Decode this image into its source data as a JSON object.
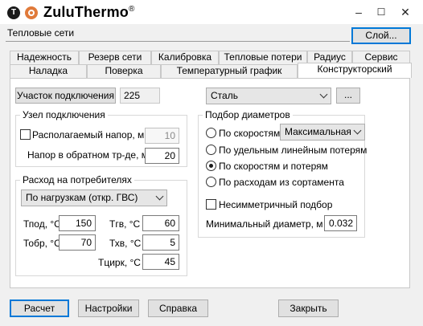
{
  "app": {
    "name": "ZuluThermo",
    "trademark": "®",
    "logo_letter": "T"
  },
  "window_controls": {
    "minimize": "–",
    "maximize": "☐",
    "close": "✕"
  },
  "layer": {
    "value": "Тепловые сети",
    "button_label": "Слой..."
  },
  "tabs_row1": [
    "Надежность",
    "Резерв сети",
    "Калибровка",
    "Тепловые потери",
    "Радиус",
    "Сервис"
  ],
  "tabs_row2": [
    "Наладка",
    "Поверка",
    "Температурный график",
    "Конструкторский"
  ],
  "active_tab": "Конструкторский",
  "connection": {
    "button_label": "Участок подключения",
    "value": "225"
  },
  "material": {
    "selected": "Сталь",
    "more_button": "..."
  },
  "node": {
    "title": "Узел подключения",
    "available_head_label": "Располагаемый напор, м",
    "available_head_checked": false,
    "available_head_value": "10",
    "return_head_label": "Напор в обратном тр-де, м",
    "return_head_value": "20"
  },
  "consumer_flow": {
    "title": "Расход на потребителях",
    "mode_selected": "По нагрузкам (откр. ГВС)",
    "tpod_label": "Тпод, °С",
    "tpod_value": "150",
    "tgv_label": "Тгв, °С",
    "tgv_value": "60",
    "tobr_label": "Тобр, °С",
    "tobr_value": "70",
    "txv_label": "Тхв, °С",
    "txv_value": "5",
    "tcirc_label": "Тцирк, °С",
    "tcirc_value": "45"
  },
  "diameter_selection": {
    "title": "Подбор диаметров",
    "options": [
      "По скоростям",
      "По удельным линейным потерям",
      "По скоростям и потерям",
      "По расходам из сортамента"
    ],
    "selected_index": 2,
    "speed_mode_selected": "Максимальная",
    "asymmetric_label": "Несимметричный подбор",
    "asymmetric_checked": false,
    "min_diameter_label": "Минимальный диаметр, м",
    "min_diameter_value": "0.032"
  },
  "footer": {
    "calc": "Расчет",
    "settings": "Настройки",
    "help": "Справка",
    "close": "Закрыть"
  }
}
